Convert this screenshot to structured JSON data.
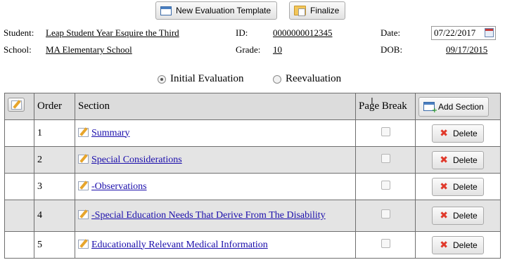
{
  "toolbar": {
    "new_template_label": "New Evaluation Template",
    "finalize_label": "Finalize"
  },
  "student_info": {
    "student_label": "Student:",
    "student_value": "Leap Student Year Esquire the Third",
    "id_label": "ID:",
    "id_value": "0000000012345",
    "date_label": "Date:",
    "date_value": "07/22/2017",
    "school_label": "School:",
    "school_value": "MA Elementary School",
    "grade_label": "Grade:",
    "grade_value": "10",
    "dob_label": "DOB:",
    "dob_value": "09/17/2015"
  },
  "evaluation_type": {
    "options": [
      "Initial Evaluation",
      "Reevaluation"
    ],
    "selected": "Initial Evaluation"
  },
  "table": {
    "headers": {
      "order": "Order",
      "section": "Section",
      "page_break": "Page Break",
      "add_section": "Add Section"
    },
    "delete_label": "Delete",
    "rows": [
      {
        "order": "1",
        "section": "Summary"
      },
      {
        "order": "2",
        "section": "Special Considerations"
      },
      {
        "order": "3",
        "section": "-Observations"
      },
      {
        "order": "4",
        "section": "-Special Education Needs That Derive From The Disability"
      },
      {
        "order": "5",
        "section": "Educationally Relevant Medical Information"
      }
    ]
  },
  "colors": {
    "link": "#1a0dab",
    "header_bg": "#dcdcdc",
    "alt_row_bg": "#e4e4e4",
    "delete_icon": "#e0392b"
  }
}
